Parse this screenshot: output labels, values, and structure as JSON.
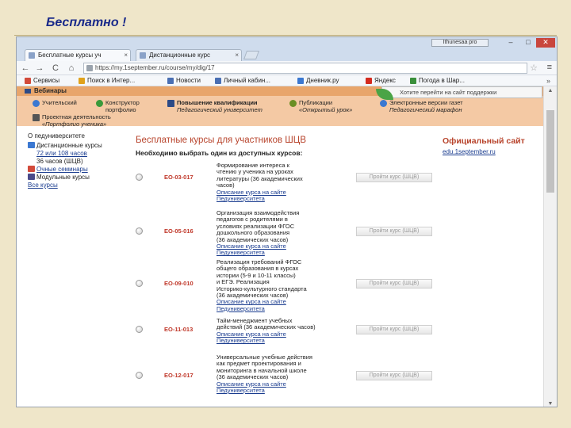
{
  "slide": {
    "title": "Бесплатно !"
  },
  "window": {
    "toolbar_label": "Ithunesaa pro",
    "min_glyph": "–",
    "max_glyph": "□",
    "close_glyph": "✕"
  },
  "tabs": [
    {
      "label": "Бесплатные курсы уч"
    },
    {
      "label": "Дистанционные курс"
    }
  ],
  "navbar": {
    "back": "←",
    "forward": "→",
    "reload": "C",
    "home": "⌂",
    "url": "https://my.1september.ru/course/my/dig/17",
    "star": "☆",
    "menu": "≡"
  },
  "bookmarks": {
    "items": [
      {
        "label": "Сервисы",
        "color": "#d24a3a"
      },
      {
        "label": "Поиск в Интер...",
        "color": "#e0a21c"
      },
      {
        "label": "Новости",
        "color": "#4a6fb3"
      },
      {
        "label": "Личный кабин...",
        "color": "#4a6fb3"
      },
      {
        "label": "Дневник.ру",
        "color": "#3b78d1"
      },
      {
        "label": "Яндекс",
        "color": "#d42a1e"
      },
      {
        "label": "Погода в Шар...",
        "color": "#3a8f3a"
      }
    ],
    "more": "»"
  },
  "popup": {
    "text": "Хотите перейти на сайт поддержки"
  },
  "site_nav": {
    "webinars": "Вебинары",
    "items": [
      {
        "label": "Учительский",
        "sub": "",
        "color": "#3b78d1"
      },
      {
        "label": "Конструктор",
        "sub": "портфолио",
        "color": "#3b9a3b"
      },
      {
        "label": "Повышение квалификации",
        "sub": "Педагогический университет",
        "color": "#2c4a86"
      },
      {
        "label": "Публикации",
        "sub": "«Открытый урок»",
        "color": "#6b8e23"
      },
      {
        "label": "Проектная деятельность",
        "sub": "«Портфолио ученика»",
        "color": "#555555"
      },
      {
        "label": "Электронные версии газет",
        "sub": "Педагогический марафон",
        "color": "#3b78d1"
      }
    ]
  },
  "sidebar": {
    "heading": "О педуниверситете",
    "items": [
      {
        "label": "Дистанционные курсы",
        "link": false,
        "icon": "#3b78d1"
      },
      {
        "label": "72 или 108 часов",
        "link": true,
        "icon": ""
      },
      {
        "label": "36 часов (ШЦВ)",
        "link": false,
        "icon": ""
      },
      {
        "label": "Очные семинары",
        "link": true,
        "icon": "#d24a3a"
      },
      {
        "label": "Модульные курсы",
        "link": false,
        "icon": "#4a4a8a"
      },
      {
        "label": "Все курсы",
        "link": true,
        "icon": ""
      }
    ]
  },
  "main": {
    "title": "Бесплатные курсы для участников ШЦВ",
    "subtitle": "Необходимо выбрать один из доступных курсов:",
    "official_title": "Официальный сайт",
    "official_link": "edu.1september.ru"
  },
  "courses": [
    {
      "code": "ЕО-03-017",
      "lines": [
        "Формирование интереса к",
        "чтению у ученика на уроках",
        "литературы (36 академических",
        "часов)"
      ],
      "description": "Описание курса на сайте",
      "university": "Педуниверситета",
      "button": "Пройти курс (ШЦВ)"
    },
    {
      "code": "ЕО-05-016",
      "lines": [
        "Организация взаимодействия",
        "педагогов с родителями в",
        "условиях реализации ФГОС",
        "дошкольного образования",
        "(36 академических часов)"
      ],
      "description": "Описание курса на сайте",
      "university": "Педуниверситета",
      "button": "Пройти курс (ШЦВ)"
    },
    {
      "code": "ЕО-09-010",
      "lines": [
        "Реализация требований ФГОС",
        "общего образования в курсах",
        "истории (5-9 и 10-11 классы)",
        "и ЕГЭ. Реализация",
        "Историко-культурного стандарта",
        "(36 академических часов)"
      ],
      "description": "Описание курса на сайте",
      "university": "Педуниверситета",
      "button": "Пройти курс (ШЦВ)"
    },
    {
      "code": "ЕО-11-013",
      "lines": [
        "Тайм-менеджмент учебных",
        "действий (36 академических часов)"
      ],
      "description": "Описание курса на сайте",
      "university": "Педуниверситета",
      "button": "Пройти курс (ШЦВ)"
    },
    {
      "code": "ЕО-12-017",
      "lines": [
        "Универсальные учебные действия",
        "как предмет проектирования и",
        "мониторинга в начальной школе",
        "(36 академических часов)"
      ],
      "description": "Описание курса на сайте",
      "university": "Педуниверситета",
      "button": "Пройти курс (ШЦВ)"
    }
  ]
}
